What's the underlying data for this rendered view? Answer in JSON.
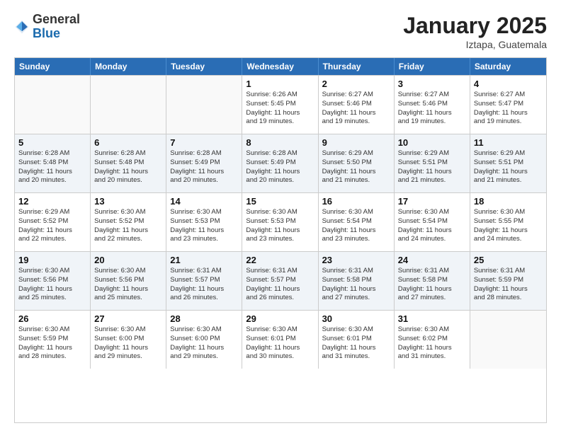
{
  "header": {
    "logo_general": "General",
    "logo_blue": "Blue",
    "month": "January 2025",
    "location": "Iztapa, Guatemala"
  },
  "days_of_week": [
    "Sunday",
    "Monday",
    "Tuesday",
    "Wednesday",
    "Thursday",
    "Friday",
    "Saturday"
  ],
  "weeks": [
    {
      "shaded": false,
      "days": [
        {
          "num": "",
          "info": ""
        },
        {
          "num": "",
          "info": ""
        },
        {
          "num": "",
          "info": ""
        },
        {
          "num": "1",
          "info": "Sunrise: 6:26 AM\nSunset: 5:45 PM\nDaylight: 11 hours\nand 19 minutes."
        },
        {
          "num": "2",
          "info": "Sunrise: 6:27 AM\nSunset: 5:46 PM\nDaylight: 11 hours\nand 19 minutes."
        },
        {
          "num": "3",
          "info": "Sunrise: 6:27 AM\nSunset: 5:46 PM\nDaylight: 11 hours\nand 19 minutes."
        },
        {
          "num": "4",
          "info": "Sunrise: 6:27 AM\nSunset: 5:47 PM\nDaylight: 11 hours\nand 19 minutes."
        }
      ]
    },
    {
      "shaded": true,
      "days": [
        {
          "num": "5",
          "info": "Sunrise: 6:28 AM\nSunset: 5:48 PM\nDaylight: 11 hours\nand 20 minutes."
        },
        {
          "num": "6",
          "info": "Sunrise: 6:28 AM\nSunset: 5:48 PM\nDaylight: 11 hours\nand 20 minutes."
        },
        {
          "num": "7",
          "info": "Sunrise: 6:28 AM\nSunset: 5:49 PM\nDaylight: 11 hours\nand 20 minutes."
        },
        {
          "num": "8",
          "info": "Sunrise: 6:28 AM\nSunset: 5:49 PM\nDaylight: 11 hours\nand 20 minutes."
        },
        {
          "num": "9",
          "info": "Sunrise: 6:29 AM\nSunset: 5:50 PM\nDaylight: 11 hours\nand 21 minutes."
        },
        {
          "num": "10",
          "info": "Sunrise: 6:29 AM\nSunset: 5:51 PM\nDaylight: 11 hours\nand 21 minutes."
        },
        {
          "num": "11",
          "info": "Sunrise: 6:29 AM\nSunset: 5:51 PM\nDaylight: 11 hours\nand 21 minutes."
        }
      ]
    },
    {
      "shaded": false,
      "days": [
        {
          "num": "12",
          "info": "Sunrise: 6:29 AM\nSunset: 5:52 PM\nDaylight: 11 hours\nand 22 minutes."
        },
        {
          "num": "13",
          "info": "Sunrise: 6:30 AM\nSunset: 5:52 PM\nDaylight: 11 hours\nand 22 minutes."
        },
        {
          "num": "14",
          "info": "Sunrise: 6:30 AM\nSunset: 5:53 PM\nDaylight: 11 hours\nand 23 minutes."
        },
        {
          "num": "15",
          "info": "Sunrise: 6:30 AM\nSunset: 5:53 PM\nDaylight: 11 hours\nand 23 minutes."
        },
        {
          "num": "16",
          "info": "Sunrise: 6:30 AM\nSunset: 5:54 PM\nDaylight: 11 hours\nand 23 minutes."
        },
        {
          "num": "17",
          "info": "Sunrise: 6:30 AM\nSunset: 5:54 PM\nDaylight: 11 hours\nand 24 minutes."
        },
        {
          "num": "18",
          "info": "Sunrise: 6:30 AM\nSunset: 5:55 PM\nDaylight: 11 hours\nand 24 minutes."
        }
      ]
    },
    {
      "shaded": true,
      "days": [
        {
          "num": "19",
          "info": "Sunrise: 6:30 AM\nSunset: 5:56 PM\nDaylight: 11 hours\nand 25 minutes."
        },
        {
          "num": "20",
          "info": "Sunrise: 6:30 AM\nSunset: 5:56 PM\nDaylight: 11 hours\nand 25 minutes."
        },
        {
          "num": "21",
          "info": "Sunrise: 6:31 AM\nSunset: 5:57 PM\nDaylight: 11 hours\nand 26 minutes."
        },
        {
          "num": "22",
          "info": "Sunrise: 6:31 AM\nSunset: 5:57 PM\nDaylight: 11 hours\nand 26 minutes."
        },
        {
          "num": "23",
          "info": "Sunrise: 6:31 AM\nSunset: 5:58 PM\nDaylight: 11 hours\nand 27 minutes."
        },
        {
          "num": "24",
          "info": "Sunrise: 6:31 AM\nSunset: 5:58 PM\nDaylight: 11 hours\nand 27 minutes."
        },
        {
          "num": "25",
          "info": "Sunrise: 6:31 AM\nSunset: 5:59 PM\nDaylight: 11 hours\nand 28 minutes."
        }
      ]
    },
    {
      "shaded": false,
      "days": [
        {
          "num": "26",
          "info": "Sunrise: 6:30 AM\nSunset: 5:59 PM\nDaylight: 11 hours\nand 28 minutes."
        },
        {
          "num": "27",
          "info": "Sunrise: 6:30 AM\nSunset: 6:00 PM\nDaylight: 11 hours\nand 29 minutes."
        },
        {
          "num": "28",
          "info": "Sunrise: 6:30 AM\nSunset: 6:00 PM\nDaylight: 11 hours\nand 29 minutes."
        },
        {
          "num": "29",
          "info": "Sunrise: 6:30 AM\nSunset: 6:01 PM\nDaylight: 11 hours\nand 30 minutes."
        },
        {
          "num": "30",
          "info": "Sunrise: 6:30 AM\nSunset: 6:01 PM\nDaylight: 11 hours\nand 31 minutes."
        },
        {
          "num": "31",
          "info": "Sunrise: 6:30 AM\nSunset: 6:02 PM\nDaylight: 11 hours\nand 31 minutes."
        },
        {
          "num": "",
          "info": ""
        }
      ]
    }
  ]
}
